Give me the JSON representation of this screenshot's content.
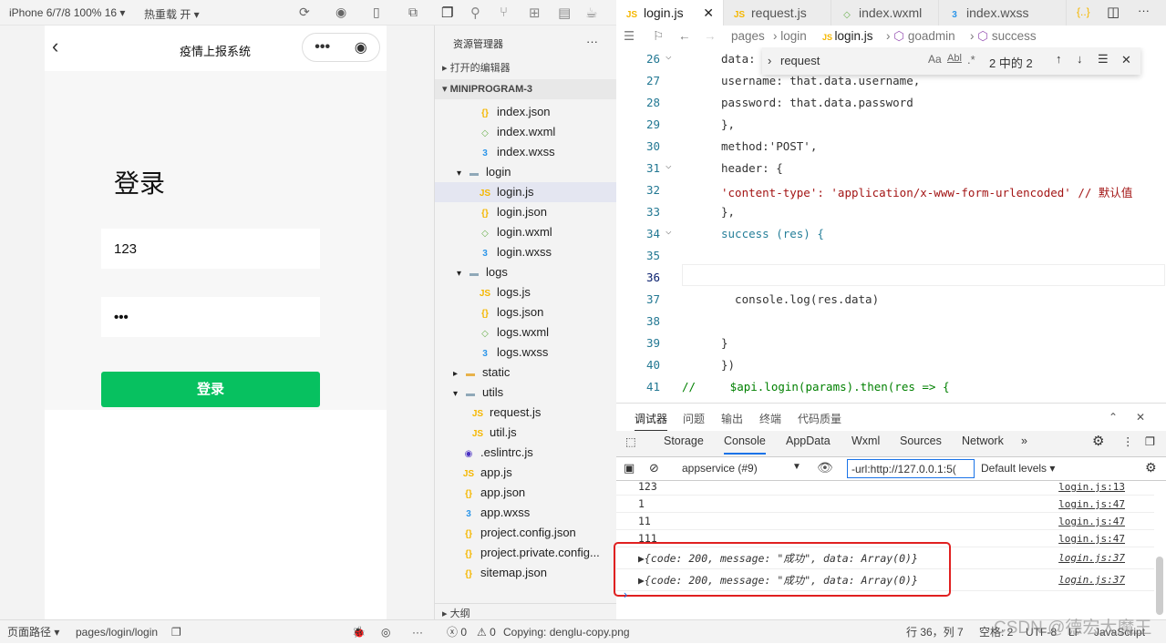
{
  "sim_toolbar": {
    "device": "iPhone 6/7/8 100% 16 ▾",
    "hot_reload": "热重载 开 ▾"
  },
  "phone": {
    "title": "疫情上报系统",
    "heading": "登录",
    "username": "123",
    "password": "•••",
    "login_button": "登录",
    "capsule_more": "•••",
    "capsule_close": "◉"
  },
  "explorer": {
    "title": "资源管理器",
    "more": "···",
    "open_editors": "打开的编辑器",
    "project": "MINIPROGRAM-3",
    "outline": "大纲",
    "items": [
      {
        "name": "index.json",
        "type": "json"
      },
      {
        "name": "index.wxml",
        "type": "wxml"
      },
      {
        "name": "index.wxss",
        "type": "wxss"
      },
      {
        "name": "login",
        "type": "folder-open"
      },
      {
        "name": "login.js",
        "type": "js",
        "selected": true
      },
      {
        "name": "login.json",
        "type": "json"
      },
      {
        "name": "login.wxml",
        "type": "wxml"
      },
      {
        "name": "login.wxss",
        "type": "wxss"
      },
      {
        "name": "logs",
        "type": "folder-open"
      },
      {
        "name": "logs.js",
        "type": "js"
      },
      {
        "name": "logs.json",
        "type": "json"
      },
      {
        "name": "logs.wxml",
        "type": "wxml"
      },
      {
        "name": "logs.wxss",
        "type": "wxss"
      },
      {
        "name": "static",
        "type": "folder"
      },
      {
        "name": "utils",
        "type": "folder-open"
      },
      {
        "name": "request.js",
        "type": "js"
      },
      {
        "name": "util.js",
        "type": "js"
      },
      {
        "name": ".eslintrc.js",
        "type": "eslint"
      },
      {
        "name": "app.js",
        "type": "js"
      },
      {
        "name": "app.json",
        "type": "json"
      },
      {
        "name": "app.wxss",
        "type": "wxss"
      },
      {
        "name": "project.config.json",
        "type": "json"
      },
      {
        "name": "project.private.config...",
        "type": "json"
      },
      {
        "name": "sitemap.json",
        "type": "json"
      }
    ]
  },
  "editor": {
    "tabs": [
      "login.js",
      "request.js",
      "index.wxml",
      "index.wxss"
    ],
    "breadcrumb": [
      "pages",
      "login",
      "login.js",
      "goadmin",
      "success"
    ],
    "find": {
      "query": "request",
      "result": "2 中的 2"
    },
    "lines": [
      {
        "n": "26",
        "t": "data:"
      },
      {
        "n": "27",
        "t": "username: that.data.username,"
      },
      {
        "n": "28",
        "t": "password: that.data.password"
      },
      {
        "n": "29",
        "t": "},"
      },
      {
        "n": "30",
        "t": "method:'POST',"
      },
      {
        "n": "31",
        "t": "header: {"
      },
      {
        "n": "32",
        "t": "'content-type': 'application/x-www-form-urlencoded' // 默认值"
      },
      {
        "n": "33",
        "t": "},"
      },
      {
        "n": "34",
        "t": "success (res) {"
      },
      {
        "n": "35",
        "t": ""
      },
      {
        "n": "36",
        "t": ""
      },
      {
        "n": "37",
        "t": "  console.log(res.data)"
      },
      {
        "n": "38",
        "t": ""
      },
      {
        "n": "39",
        "t": "}"
      },
      {
        "n": "40",
        "t": "})"
      },
      {
        "n": "41",
        "t": "//     $api.login(params).then(res => {"
      }
    ]
  },
  "devtools": {
    "tabs": [
      "调试器",
      "问题",
      "输出",
      "终端",
      "代码质量"
    ],
    "panel_tabs": [
      "Storage",
      "Console",
      "AppData",
      "Wxml",
      "Sources",
      "Network",
      "»"
    ],
    "context": "appservice (#9)",
    "filter": "-url:http://127.0.0.1:5(",
    "levels": "Default levels ▾",
    "logs": [
      {
        "v": "123",
        "src": "login.js:13"
      },
      {
        "v": "1",
        "src": "login.js:47"
      },
      {
        "v": "11",
        "src": "login.js:47"
      },
      {
        "v": "111",
        "src": "login.js:47"
      },
      {
        "v": "▶{code: 200, message: \"成功\", data: Array(0)}",
        "src": "login.js:37"
      },
      {
        "v": "▶{code: 200, message: \"成功\", data: Array(0)}",
        "src": "login.js:37"
      }
    ],
    "highlight_color": "#e02020"
  },
  "status": {
    "page_path_label": "页面路径 ▾",
    "page_path": "pages/login/login",
    "errors": "ⓧ 0",
    "warnings": "⚠ 0",
    "message": "Copying: denglu-copy.png",
    "position": "行 36，列 7",
    "indent": "空格: 2",
    "encoding": "UTF-8",
    "eol": "LF",
    "language": "JavaScript",
    "watermark": "CSDN @德宏大魔王"
  }
}
